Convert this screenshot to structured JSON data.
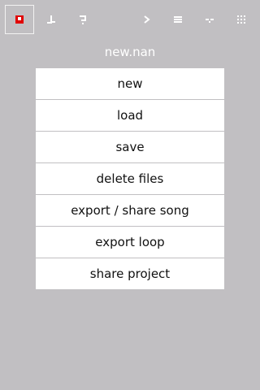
{
  "colors": {
    "background": "#c1bfc2",
    "icon": "#ffffff",
    "active_icon": "#e00000",
    "button_background": "#ffffff",
    "button_text": "#111111"
  },
  "toolbar": {
    "items": [
      {
        "icon": "project-icon",
        "active": true
      },
      {
        "icon": "pattern-icon",
        "active": false
      },
      {
        "icon": "question-icon",
        "active": false
      },
      {
        "icon": "play-icon",
        "active": false
      },
      {
        "icon": "menu-icon",
        "active": false
      },
      {
        "icon": "dash-icon",
        "active": false
      },
      {
        "icon": "grid-icon",
        "active": false
      }
    ]
  },
  "project": {
    "title": "new.nan"
  },
  "menu": {
    "items": [
      {
        "label": "new"
      },
      {
        "label": "load"
      },
      {
        "label": "save"
      },
      {
        "label": "delete files"
      },
      {
        "label": "export / share song"
      },
      {
        "label": "export loop"
      },
      {
        "label": "share project"
      }
    ]
  }
}
